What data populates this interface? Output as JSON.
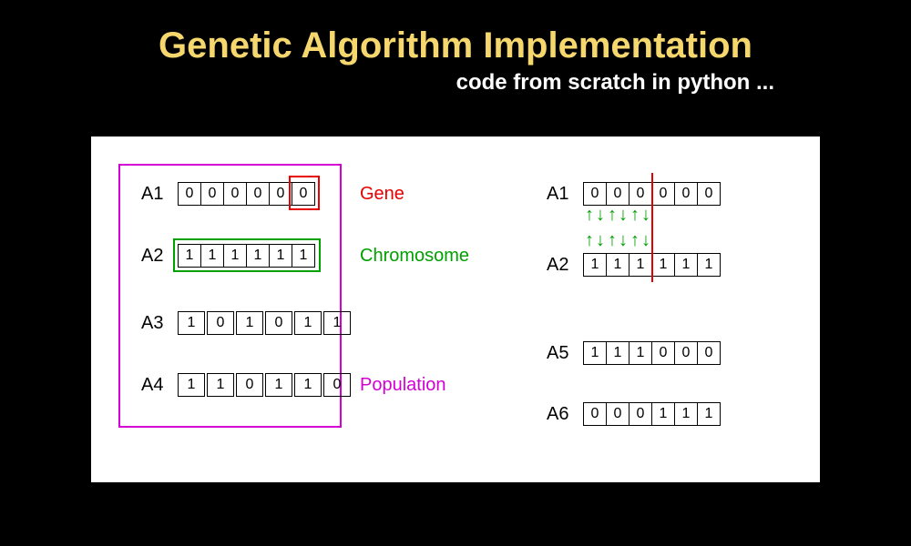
{
  "title": "Genetic Algorithm Implementation",
  "subtitle": "code from scratch in python ...",
  "labels": {
    "gene": "Gene",
    "chromosome": "Chromosome",
    "population": "Population"
  },
  "left": {
    "A1": {
      "name": "A1",
      "bits": [
        "0",
        "0",
        "0",
        "0",
        "0",
        "0"
      ]
    },
    "A2": {
      "name": "A2",
      "bits": [
        "1",
        "1",
        "1",
        "1",
        "1",
        "1"
      ]
    },
    "A3": {
      "name": "A3",
      "bits": [
        "1",
        "0",
        "1",
        "0",
        "1",
        "1"
      ]
    },
    "A4": {
      "name": "A4",
      "bits": [
        "1",
        "1",
        "0",
        "1",
        "1",
        "0"
      ]
    }
  },
  "right": {
    "A1": {
      "name": "A1",
      "bits": [
        "0",
        "0",
        "0",
        "0",
        "0",
        "0"
      ]
    },
    "A2": {
      "name": "A2",
      "bits": [
        "1",
        "1",
        "1",
        "1",
        "1",
        "1"
      ]
    },
    "A5": {
      "name": "A5",
      "bits": [
        "1",
        "1",
        "1",
        "0",
        "0",
        "0"
      ]
    },
    "A6": {
      "name": "A6",
      "bits": [
        "0",
        "0",
        "0",
        "1",
        "1",
        "1"
      ]
    }
  },
  "crossover_point": 3
}
